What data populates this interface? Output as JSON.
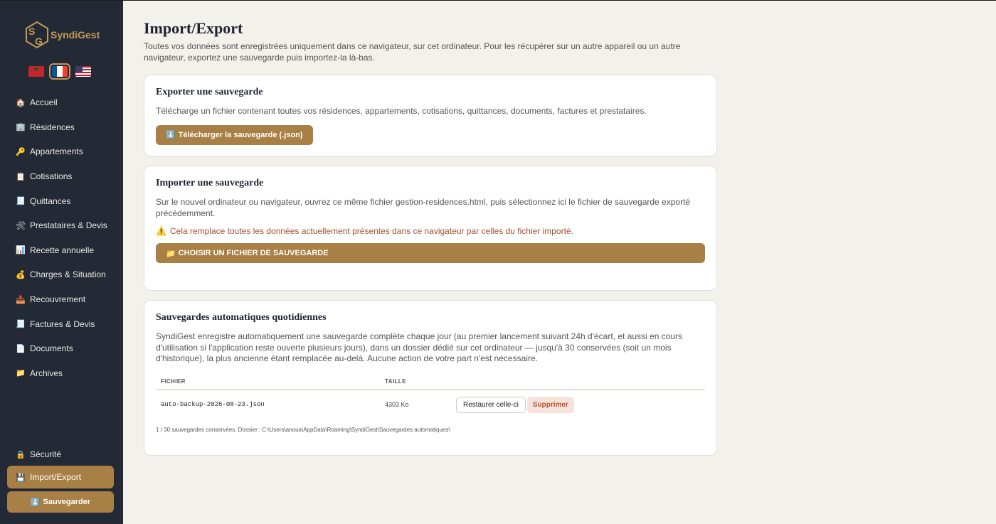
{
  "app": {
    "name": "SyndiGest"
  },
  "colors": {
    "sidebar_bg": "#232a36",
    "accent": "#a87f45",
    "page_bg": "#f3f1eb",
    "warning": "#a0522d"
  },
  "languages": [
    {
      "code": "ma",
      "icon": "morocco-flag-icon"
    },
    {
      "code": "fr",
      "icon": "france-flag-icon",
      "active": true
    },
    {
      "code": "us",
      "icon": "usa-flag-icon"
    }
  ],
  "sidebar": {
    "items": [
      {
        "label": "Accueil",
        "icon": "🏠"
      },
      {
        "label": "Résidences",
        "icon": "🏢"
      },
      {
        "label": "Appartements",
        "icon": "🔑"
      },
      {
        "label": "Cotisations",
        "icon": "📋"
      },
      {
        "label": "Quittances",
        "icon": "🧾"
      },
      {
        "label": "Prestataires & Devis",
        "icon": "🛠"
      },
      {
        "label": "Recette annuelle",
        "icon": "📊"
      },
      {
        "label": "Charges & Situation",
        "icon": "💰"
      },
      {
        "label": "Recouvrement",
        "icon": "📥"
      },
      {
        "label": "Factures & Devis",
        "icon": "🧾"
      },
      {
        "label": "Documents",
        "icon": "📄"
      },
      {
        "label": "Archives",
        "icon": "📁"
      }
    ],
    "bottom_items": [
      {
        "label": "Sécurité",
        "icon": "🔒"
      },
      {
        "label": "Import/Export",
        "icon": "💾",
        "active": true
      }
    ],
    "save_label": "Sauvegarder",
    "save_icon": "⬇️"
  },
  "page": {
    "title": "Import/Export",
    "description": "Toutes vos données sont enregistrées uniquement dans ce navigateur, sur cet ordinateur. Pour les récupérer sur un autre appareil ou un autre navigateur, exportez une sauvegarde puis importez-la là-bas."
  },
  "export_card": {
    "title": "Exporter une sauvegarde",
    "text": "Télécharge un fichier contenant toutes vos résidences, appartements, cotisations, quittances, documents, factures et prestataires.",
    "button_icon": "⬇️",
    "button_label": "Télécharger la sauvegarde (.json)"
  },
  "import_card": {
    "title": "Importer une sauvegarde",
    "text": "Sur le nouvel ordinateur ou navigateur, ouvrez ce même fichier gestion-residences.html, puis sélectionnez ici le fichier de sauvegarde exporté précédemment.",
    "warning_icon": "⚠️",
    "warning": "Cela remplace toutes les données actuellement présentes dans ce navigateur par celles du fichier importé.",
    "button_icon": "📁",
    "button_label": "Choisir un fichier de sauvegarde"
  },
  "auto_card": {
    "title": "Sauvegardes automatiques quotidiennes",
    "text": "SyndiGest enregistre automatiquement une sauvegarde complète chaque jour (au premier lancement suivant 24h d'écart, et aussi en cours d'utilisation si l'application reste ouverte plusieurs jours), dans un dossier dédié sur cet ordinateur — jusqu'à 30 conservées (soit un mois d'historique), la plus ancienne étant remplacée au-delà. Aucune action de votre part n'est nécessaire.",
    "columns": [
      "FICHIER",
      "TAILLE",
      ""
    ],
    "rows": [
      {
        "file": "auto-backup-2026-08-23.json",
        "size": "4303 Ko",
        "restore": "Restaurer celle-ci",
        "delete": "Supprimer"
      }
    ],
    "footnote": "1 / 30 sauvegardes conservées. Dossier : C:\\Users\\anoua\\AppData\\Roaming\\SyndiGest\\Sauvegardes automatiques\\"
  }
}
